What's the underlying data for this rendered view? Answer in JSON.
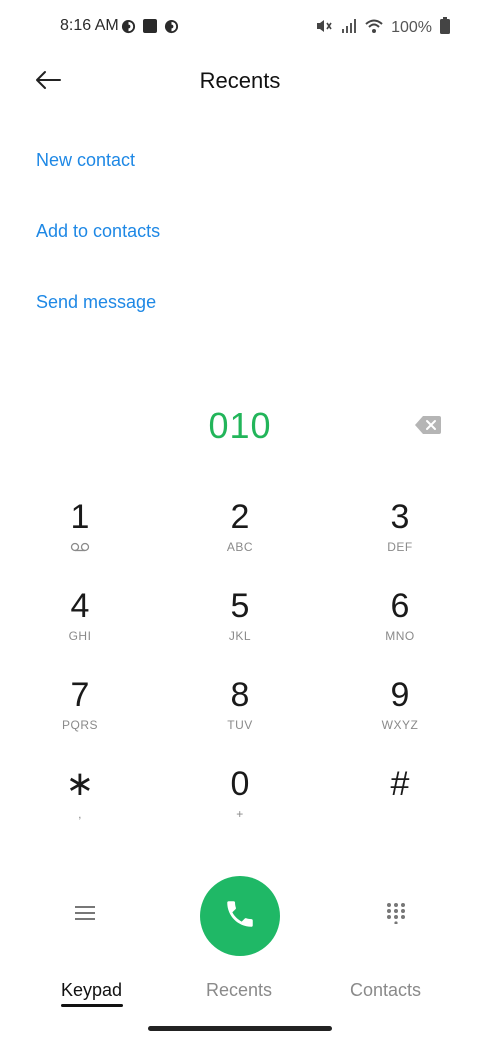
{
  "status_bar": {
    "time": "8:16 AM",
    "battery": "100%",
    "icons": [
      "data-saver-icon",
      "square-notification-icon",
      "data-saver-icon",
      "mute-icon",
      "signal-icon",
      "wifi-icon",
      "battery-icon"
    ]
  },
  "header": {
    "title": "Recents",
    "back_icon": "back-arrow-icon"
  },
  "actions": {
    "new_contact": "New contact",
    "add_to_contacts": "Add to contacts",
    "send_message": "Send message"
  },
  "dialer": {
    "number": "010",
    "number_color": "#22b55a",
    "backspace_icon": "backspace-icon"
  },
  "keypad": {
    "keys": [
      {
        "digit": "1",
        "sub": ""
      },
      {
        "digit": "2",
        "sub": "ABC"
      },
      {
        "digit": "3",
        "sub": "DEF"
      },
      {
        "digit": "4",
        "sub": "GHI"
      },
      {
        "digit": "5",
        "sub": "JKL"
      },
      {
        "digit": "6",
        "sub": "MNO"
      },
      {
        "digit": "7",
        "sub": "PQRS"
      },
      {
        "digit": "8",
        "sub": "TUV"
      },
      {
        "digit": "9",
        "sub": "WXYZ"
      },
      {
        "digit": "∗",
        "sub": ","
      },
      {
        "digit": "0",
        "sub": "+"
      },
      {
        "digit": "#",
        "sub": ""
      }
    ],
    "voicemail_icon": "voicemail-icon"
  },
  "controls": {
    "menu_icon": "menu-icon",
    "call_icon": "phone-icon",
    "call_color": "#1fb866",
    "dialpad_icon": "dialpad-icon"
  },
  "tabs": [
    {
      "label": "Keypad",
      "active": true
    },
    {
      "label": "Recents",
      "active": false
    },
    {
      "label": "Contacts",
      "active": false
    }
  ],
  "colors": {
    "link": "#1e88e5"
  }
}
